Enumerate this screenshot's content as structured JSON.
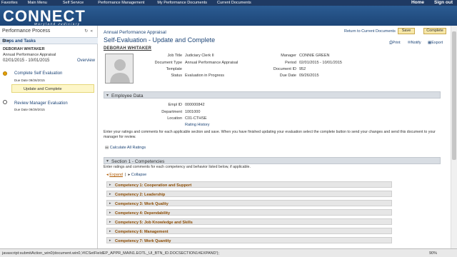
{
  "topnav": {
    "items": [
      "Favorites",
      "Main Menu",
      "Self Service",
      "Performance Management",
      "My Performance Documents",
      "Current Documents"
    ],
    "home": "Home",
    "signout": "Sign out"
  },
  "banner": {
    "logo": "CONNECT",
    "sub": "Maryland Judiciary"
  },
  "left": {
    "title": "Performance Process",
    "steps_header": "Steps and Tasks",
    "employee": "DEBORAH WHITAKER",
    "appraisal": "Annual Performance Appraisal",
    "dates": "02/01/2015  -  10/01/2015",
    "overview": "Overview",
    "step1": {
      "label": "Complete Self Evaluation",
      "due": "Due Date  09/26/2015",
      "task": "Update and Complete"
    },
    "step2": {
      "label": "Review Manager Evaluation",
      "due": "Due Date  09/29/2015"
    }
  },
  "main": {
    "breadcrumb": "Annual Performance Appraisal",
    "return": "Return to Current Documents",
    "save": "Save",
    "complete": "Complete",
    "title": "Self-Evaluation - Update and Complete",
    "name": "DEBORAH WHITAKER",
    "print": "Print",
    "notify": "Notify",
    "export": "Export",
    "fields": {
      "job_title": {
        "label": "Job Title",
        "value": "Judiciary Clerk II"
      },
      "doc_type": {
        "label": "Document Type",
        "value": "Annual Performance Appraisal"
      },
      "template": {
        "label": "Template",
        "value": ""
      },
      "status": {
        "label": "Status",
        "value": "Evaluation in Progress"
      },
      "manager": {
        "label": "Manager",
        "value": "CONNIE GREEN"
      },
      "period": {
        "label": "Period",
        "value": "02/01/2015  -  10/01/2015"
      },
      "doc_id": {
        "label": "Document ID",
        "value": "952"
      },
      "due_date": {
        "label": "Due Date",
        "value": "09/26/2015"
      }
    },
    "employee_data": {
      "header": "Employee Data",
      "empl_id": {
        "label": "Empl ID",
        "value": "000000842"
      },
      "department": {
        "label": "Department",
        "value": "1001000"
      },
      "location": {
        "label": "Location",
        "value": "C01-CTHSE"
      },
      "rating_history": "Rating History"
    },
    "instructions": "Enter your ratings and comments for each applicable section and save. When you have finished updating your evaluation select the complete button to send your changes and send this document to your manager for review.",
    "calc": "Calculate All Ratings",
    "section1": {
      "header": "Section 1 - Competencies",
      "text": "Enter ratings and comments for each competency and behavior listed below, if applicable.",
      "expand": "Expand",
      "collapse": "Collapse",
      "competencies": [
        "Competency 1: Cooperation and Support",
        "Competency 2: Leadership",
        "Competency 3: Work Quality",
        "Competency 4: Dependability",
        "Competency 5: Job Knowledge and Skills",
        "Competency 6: Management",
        "Competency 7: Work Quantity"
      ]
    }
  },
  "status": {
    "text": "javascript:submitAction_win0(document.win0,'#ICSetFieldEP_APPR_MAIN1.EOTL_UI_BTN_ID.DOCSECTION1#EXPAND');",
    "zoom": "90%"
  }
}
